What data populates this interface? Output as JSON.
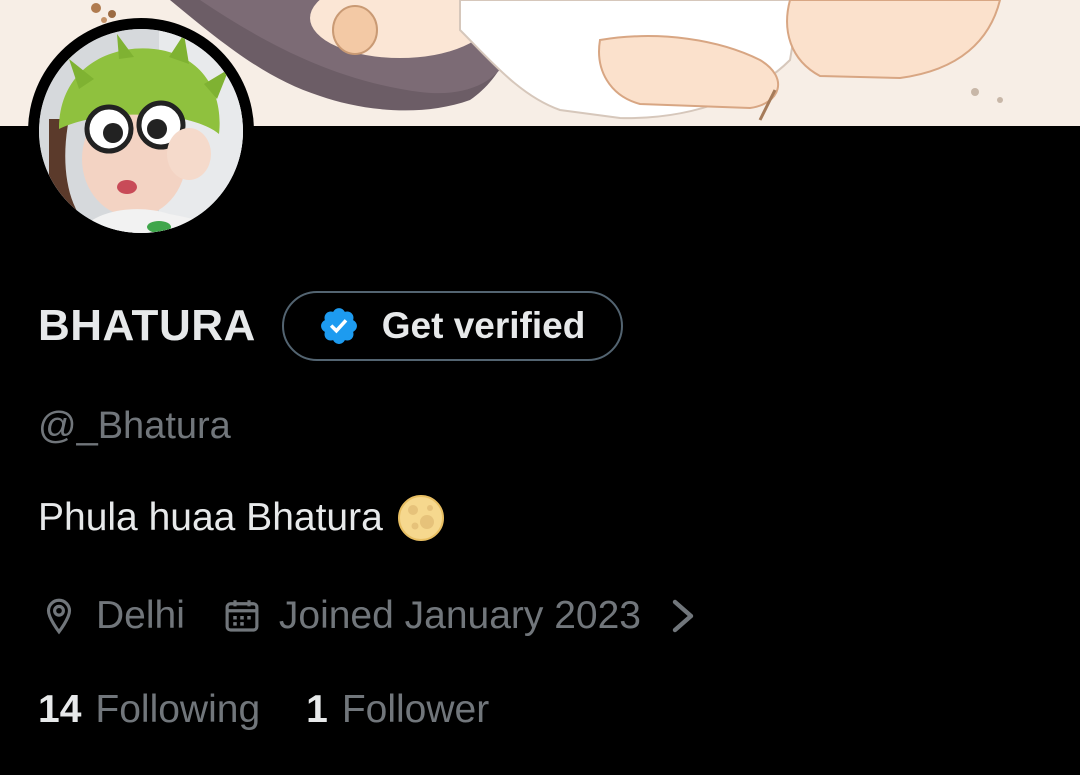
{
  "profile": {
    "display_name": "BHATURA",
    "handle": "@_Bhatura",
    "bio": "Phula huaa Bhatura",
    "bio_emoji": "full-moon-emoji",
    "location": "Delhi",
    "joined": "Joined January 2023"
  },
  "verify": {
    "label": "Get verified",
    "badge_color": "#1d9bf0"
  },
  "stats": {
    "following_count": "14",
    "following_label": "Following",
    "followers_count": "1",
    "followers_label": "Follower"
  },
  "icons": {
    "location": "location-pin-icon",
    "calendar": "calendar-icon",
    "chevron": "chevron-right-icon",
    "verified": "verified-badge-icon"
  },
  "colors": {
    "background": "#000000",
    "primary_text": "#e7e9ea",
    "secondary_text": "#71767b",
    "accent": "#1d9bf0"
  }
}
